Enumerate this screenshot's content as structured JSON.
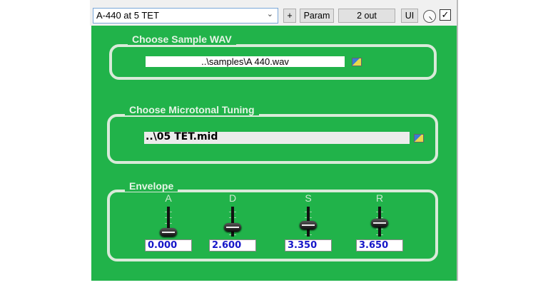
{
  "toolbar": {
    "preset": "A-440 at 5 TET",
    "add_label": "+",
    "param_label": "Param",
    "outputs_label": "2 out",
    "ui_label": "UI",
    "bypass_checked": true
  },
  "sample": {
    "title": "Choose Sample WAV",
    "path": "..\\samples\\A 440.wav"
  },
  "tuning": {
    "title": "Choose Microtonal Tuning",
    "path": "..\\05 TET.mid"
  },
  "envelope": {
    "title": "Envelope",
    "sliders": [
      {
        "label": "A",
        "value": "0.000"
      },
      {
        "label": "D",
        "value": "2.600"
      },
      {
        "label": "S",
        "value": "3.350"
      },
      {
        "label": "R",
        "value": "3.650"
      }
    ]
  },
  "colors": {
    "background": "#21b34a",
    "value_text": "#1616c8"
  }
}
